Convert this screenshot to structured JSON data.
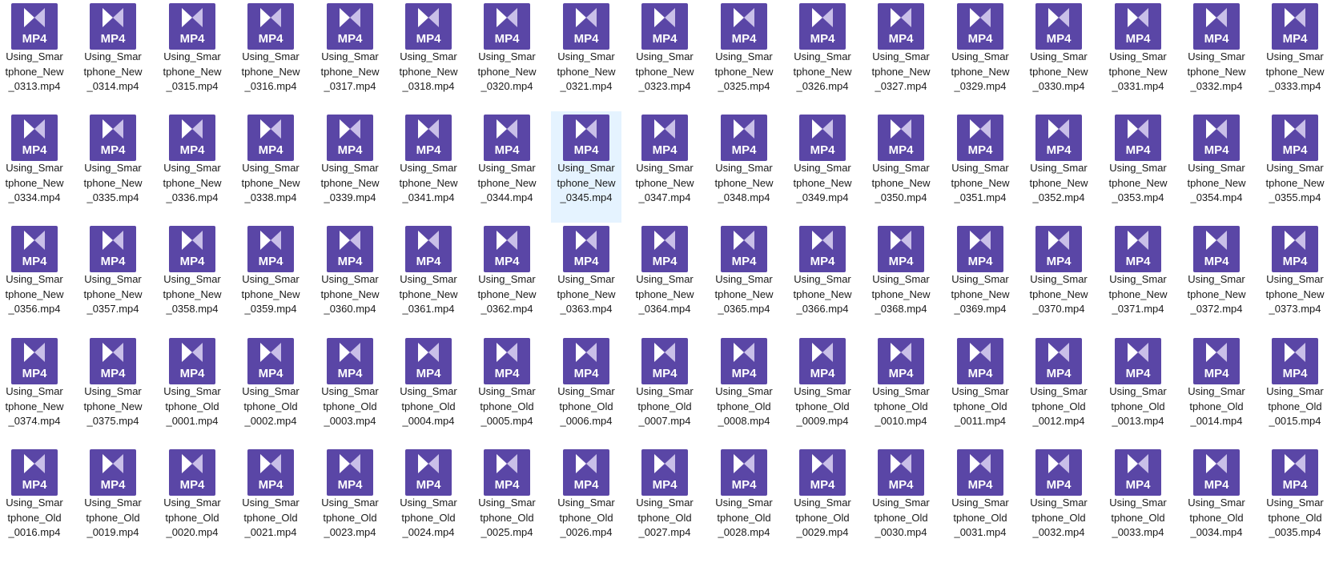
{
  "file_view": {
    "icon_label": "MP4",
    "icon_name": "mp4-video-file-icon",
    "icon_color": "#5a46a6",
    "selected_file": "Using_Smartphone_New_0345.mp4",
    "files": [
      "Using_Smartphone_New_0313.mp4",
      "Using_Smartphone_New_0314.mp4",
      "Using_Smartphone_New_0315.mp4",
      "Using_Smartphone_New_0316.mp4",
      "Using_Smartphone_New_0317.mp4",
      "Using_Smartphone_New_0318.mp4",
      "Using_Smartphone_New_0320.mp4",
      "Using_Smartphone_New_0321.mp4",
      "Using_Smartphone_New_0323.mp4",
      "Using_Smartphone_New_0325.mp4",
      "Using_Smartphone_New_0326.mp4",
      "Using_Smartphone_New_0327.mp4",
      "Using_Smartphone_New_0329.mp4",
      "Using_Smartphone_New_0330.mp4",
      "Using_Smartphone_New_0331.mp4",
      "Using_Smartphone_New_0332.mp4",
      "Using_Smartphone_New_0333.mp4",
      "Using_Smartphone_New_0334.mp4",
      "Using_Smartphone_New_0335.mp4",
      "Using_Smartphone_New_0336.mp4",
      "Using_Smartphone_New_0338.mp4",
      "Using_Smartphone_New_0339.mp4",
      "Using_Smartphone_New_0341.mp4",
      "Using_Smartphone_New_0344.mp4",
      "Using_Smartphone_New_0345.mp4",
      "Using_Smartphone_New_0347.mp4",
      "Using_Smartphone_New_0348.mp4",
      "Using_Smartphone_New_0349.mp4",
      "Using_Smartphone_New_0350.mp4",
      "Using_Smartphone_New_0351.mp4",
      "Using_Smartphone_New_0352.mp4",
      "Using_Smartphone_New_0353.mp4",
      "Using_Smartphone_New_0354.mp4",
      "Using_Smartphone_New_0355.mp4",
      "Using_Smartphone_New_0356.mp4",
      "Using_Smartphone_New_0357.mp4",
      "Using_Smartphone_New_0358.mp4",
      "Using_Smartphone_New_0359.mp4",
      "Using_Smartphone_New_0360.mp4",
      "Using_Smartphone_New_0361.mp4",
      "Using_Smartphone_New_0362.mp4",
      "Using_Smartphone_New_0363.mp4",
      "Using_Smartphone_New_0364.mp4",
      "Using_Smartphone_New_0365.mp4",
      "Using_Smartphone_New_0366.mp4",
      "Using_Smartphone_New_0368.mp4",
      "Using_Smartphone_New_0369.mp4",
      "Using_Smartphone_New_0370.mp4",
      "Using_Smartphone_New_0371.mp4",
      "Using_Smartphone_New_0372.mp4",
      "Using_Smartphone_New_0373.mp4",
      "Using_Smartphone_New_0374.mp4",
      "Using_Smartphone_New_0375.mp4",
      "Using_Smartphone_Old_0001.mp4",
      "Using_Smartphone_Old_0002.mp4",
      "Using_Smartphone_Old_0003.mp4",
      "Using_Smartphone_Old_0004.mp4",
      "Using_Smartphone_Old_0005.mp4",
      "Using_Smartphone_Old_0006.mp4",
      "Using_Smartphone_Old_0007.mp4",
      "Using_Smartphone_Old_0008.mp4",
      "Using_Smartphone_Old_0009.mp4",
      "Using_Smartphone_Old_0010.mp4",
      "Using_Smartphone_Old_0011.mp4",
      "Using_Smartphone_Old_0012.mp4",
      "Using_Smartphone_Old_0013.mp4",
      "Using_Smartphone_Old_0014.mp4",
      "Using_Smartphone_Old_0015.mp4",
      "Using_Smartphone_Old_0016.mp4",
      "Using_Smartphone_Old_0019.mp4",
      "Using_Smartphone_Old_0020.mp4",
      "Using_Smartphone_Old_0021.mp4",
      "Using_Smartphone_Old_0023.mp4",
      "Using_Smartphone_Old_0024.mp4",
      "Using_Smartphone_Old_0025.mp4",
      "Using_Smartphone_Old_0026.mp4",
      "Using_Smartphone_Old_0027.mp4",
      "Using_Smartphone_Old_0028.mp4",
      "Using_Smartphone_Old_0029.mp4",
      "Using_Smartphone_Old_0030.mp4",
      "Using_Smartphone_Old_0031.mp4",
      "Using_Smartphone_Old_0032.mp4",
      "Using_Smartphone_Old_0033.mp4",
      "Using_Smartphone_Old_0034.mp4",
      "Using_Smartphone_Old_0035.mp4"
    ]
  }
}
